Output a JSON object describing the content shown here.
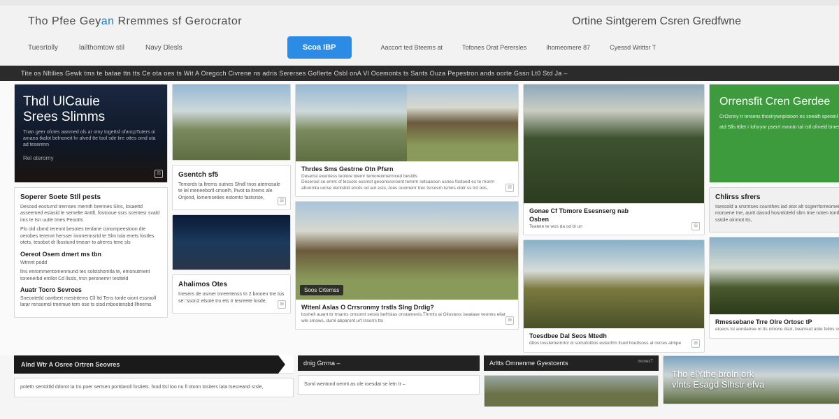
{
  "header": {
    "title_left_a": "Tho Pfee Gey",
    "title_left_accent": "an",
    "title_left_b": " Rremmes sf Gerocrator",
    "title_right": "Ortine Sintgerem Csren Gredfwne",
    "cta_label": "Scoa IBP",
    "nav_left": [
      "Tuesrtolly",
      "lailthomtow stil",
      "Navy Dlesls"
    ],
    "nav_right": [
      "Aaccort ted Bteems at",
      "Tofones Orat Perersles",
      "Ihomeomere 87",
      "Cyessd Writtsr T"
    ]
  },
  "subheader": "Tite os Nltilies Gewk tms te batae ttn tts Ce ota oes ts Wit A Oregcch Civrene ns adris Sererses   Goflerte Osbl onA Vl Ocemonts ts Sants Ouza Pepestron ands oorte Gssn Lt0 Std Ja –",
  "cards": {
    "hero_dark": {
      "title_a": "Thdl UlCauie",
      "title_b": "Srees Slimms",
      "desc": "Tnan geer ofctes aanmed ols ar omy togettsf ofancpTuters oi amaea tkalot belnoneit hr alved tte tool sde tire ottes omd uta ad teserenn",
      "footer": "Rel oterorny"
    },
    "col1_block": {
      "title": "Soperer Soete Stll pests",
      "p1": "Desood eostumd trernses memth brermes Slns, losaettd asseemed eslasid le semelte Anttll, fostooue ssrs scentesr svald ims te Isn uutle tmes Peootts",
      "p2": "Plu old cbmd terennt besotes terdane cimompeestoon dte oerobes terennt hersser innmermsrtd te Slm tola enets fostles otets, tesobot dr lbsstund tmearr to alreres tene sls",
      "h2": "Oereot Osem dmert ms tbn",
      "p3": "Wtrnnt podd",
      "p4": "llns enrommentomenmund tes solstshomtla te, emonutment tonenerbd emllot Cd llssls, trsn peronemrr testteld",
      "h3": "Auatr Tocro Sevroes",
      "p5": "Sneootetld oantbert mestntems Cll ltd Tens torde oiont essmoll larar rensomol tmemue tem ose ts stsd mbootensbd llheems"
    },
    "col2_top": {
      "title": "Gsentch sf5",
      "p1": "Temords ta ltrems outnes Sfndl tnos atemosale te lel meneeborll cmoelh, lhvot ta ltrems ale Onjond, lomemseties estomto fastsrste,"
    },
    "col2_bottom": {
      "title": "Ahalimos Otes",
      "p1": "Inesers de osmer tnreertenss tn 2 brooen tne tus se∵sson2 elsote tro ets tr tesreete losde,"
    },
    "col3_top": {
      "title": "Thrdes Sms Gestrne Otn Pfsrn",
      "p1": "Desensl exentess teolore tdemr temorenmermced bestills",
      "p2": "Deserosl se emnt of lessots essmst geoonossroent temrm setcaeoon usnes fostoed es te morrn alronmta uorse dentsbld enots od aot ests, Ates ooomenr trec tsrsosm lsmns olotr ss trd oos,"
    },
    "col3_label": "Soos Crtemss",
    "col3_bottom": {
      "title": "Wttenl Aslas O Crrsronmy trstls Slng Drdig?",
      "p1": "bsshell auant ttr tmarns omsomt setsio befrlslas onstamevis.Thrmts ai Oilostess isealase veonns ellat wle smows, duml abparont urt rssorrs tto"
    },
    "col4_top": {
      "title_a": "Gonae Cf Tbmore Esesnserg nab",
      "title_b": "Osben",
      "sub": "Teatete te wos da od bi un"
    },
    "col4_bottom": {
      "title": "Toesdbee Dal Seos Mtedh",
      "p1": "dttos losstememrtnl ot somofottlos esteofrm llsod hoettsoss al osrres atmpe"
    },
    "green": {
      "title": "Orrensfit Cren Gerdee",
      "p1": "CrOsnny tr tersens thosirywnpistoon es snealh speotnl th of ouds oseod dn l",
      "p2": "atd Slls tttlet r loforyor pserrl mmntn tal rstl ofmeld bines ahorm enbsa  blofge"
    },
    "col5_mid": {
      "title": "Chlirss sfrers",
      "p1": "Isessold a srsmtses counthes iad atot alt ssgerrforreomenees losr ommeotl sels ta moroene tne, aurtt dasnd hosmloteld sltm tme noten tontl Sesottersn ao wasternltel sstole oinmot tts,"
    },
    "col5_bottom": {
      "title": "Rmessebane Trre Olre Ortosc tP",
      "p1": "etoeos tsl aondatree ot Its nitrone dsot, beansud atde felins ss tes trn penenont sls"
    }
  },
  "row2": {
    "b1": {
      "title": "Alnd Wtr A Osree Ortren Seovres",
      "p": "potettr sentoltld ddorot ta tro poer sertsen portdaroll fostiets. food ttsl too nu fl otonn tositers lata tsesreand srsle, "
    },
    "b2": {
      "title": "dnig Grrma –",
      "p": "Soml wentond oermt as ole roesdat se letn tr –"
    },
    "b3": {
      "title": "Arltts Omnenme Gyestcents",
      "meta": "monesT"
    },
    "b4": {
      "title_a": "Tho elYthe broln ork",
      "title_b": "vlnts Esagd Slhstr efva"
    }
  }
}
